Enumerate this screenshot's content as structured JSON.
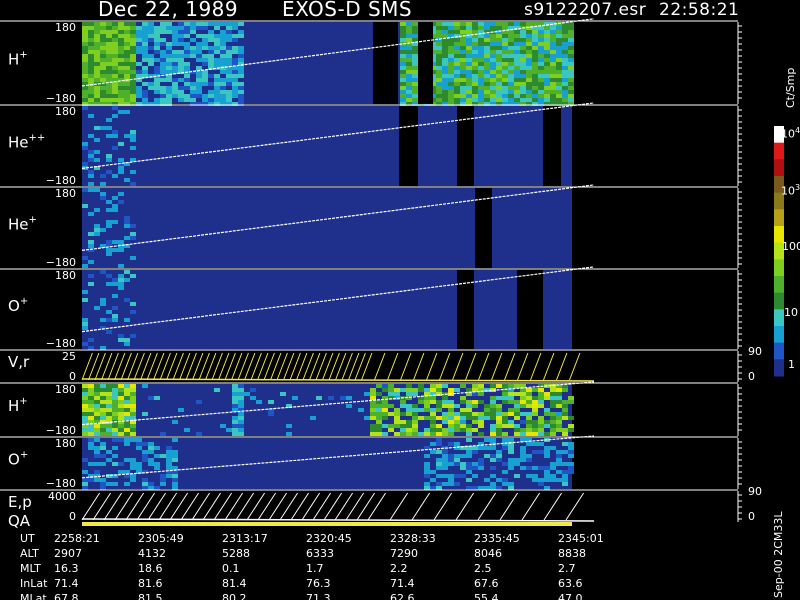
{
  "header": {
    "date": "Dec 22, 1989",
    "mission": "EXOS-D SMS",
    "file": "s9122207.esr",
    "time": "22:58:21"
  },
  "colorbar": {
    "unit": "Ct/Smp",
    "ticks": [
      "1",
      "10",
      "100",
      "10^3",
      "10^4"
    ],
    "colors": [
      "#1e2f8c",
      "#1f55c4",
      "#18a0d2",
      "#3cc6c0",
      "#2e8a2e",
      "#4fb02c",
      "#7fcf20",
      "#b6e21a",
      "#e6e600",
      "#b5a21a",
      "#8a7a1a",
      "#7a5a1a",
      "#b01010",
      "#e01818",
      "#ffffff"
    ]
  },
  "footer_note": "Sep-00 2CM33L",
  "chart_data": {
    "type": "heatmap",
    "title": "Dec 22, 1989 EXOS-D SMS",
    "x_ticks": [
      "2258:21",
      "2305:49",
      "2313:17",
      "2320:45",
      "2328:33",
      "2335:45",
      "2345:01"
    ],
    "panels": [
      {
        "label": "H+",
        "ymax": "180",
        "ymin": "−180",
        "kind": "spectrogram"
      },
      {
        "label": "He++",
        "ymax": "180",
        "ymin": "−180",
        "kind": "spectrogram"
      },
      {
        "label": "He+",
        "ymax": "180",
        "ymin": "−180",
        "kind": "spectrogram"
      },
      {
        "label": "O+",
        "ymax": "180",
        "ymin": "−180",
        "kind": "spectrogram"
      },
      {
        "label": "V,r",
        "ymax": "25",
        "ymin": "0",
        "right_top": "90",
        "right_bottom": "0",
        "kind": "lines"
      },
      {
        "label": "H+",
        "ymax": "180",
        "ymin": "−180",
        "kind": "spectrogram"
      },
      {
        "label": "O+",
        "ymax": "180",
        "ymin": "−180",
        "kind": "spectrogram"
      },
      {
        "label": "E,p",
        "sublabel": "QA",
        "ymax": "4000",
        "ymin": "0",
        "right_top": "90",
        "right_bottom": "0",
        "kind": "lines"
      }
    ],
    "ephemeris": [
      {
        "name": "UT",
        "values": [
          "2258:21",
          "2305:49",
          "2313:17",
          "2320:45",
          "2328:33",
          "2335:45",
          "2345:01"
        ]
      },
      {
        "name": "ALT",
        "values": [
          "2907",
          "4132",
          "5288",
          "6333",
          "7290",
          "8046",
          "8838"
        ]
      },
      {
        "name": "MLT",
        "values": [
          "16.3",
          "18.6",
          "0.1",
          "1.7",
          "2.2",
          "2.5",
          "2.7"
        ]
      },
      {
        "name": "InLat",
        "values": [
          "71.4",
          "81.6",
          "81.4",
          "76.3",
          "71.4",
          "67.6",
          "63.6"
        ]
      },
      {
        "name": "MLat",
        "values": [
          "67.8",
          "81.5",
          "80.2",
          "71.3",
          "62.6",
          "55.4",
          "47.0"
        ]
      }
    ]
  }
}
